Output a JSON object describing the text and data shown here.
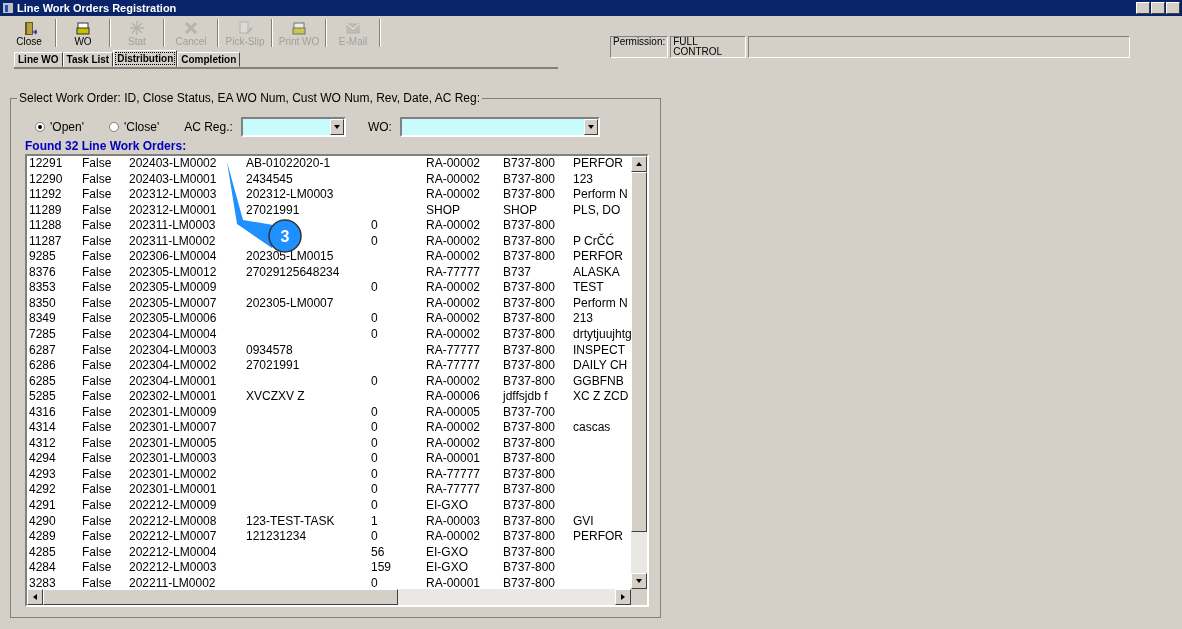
{
  "window": {
    "title": "Line Work Orders Registration"
  },
  "toolbar": [
    {
      "label": "Close",
      "kind": "door",
      "disabled": false
    },
    {
      "label": "WO",
      "kind": "printer",
      "disabled": false
    },
    {
      "label": "Stat",
      "kind": "star",
      "disabled": true
    },
    {
      "label": "Cancel",
      "kind": "cross",
      "disabled": true
    },
    {
      "label": "Pick-Slip",
      "kind": "slip",
      "disabled": true
    },
    {
      "label": "Print WO",
      "kind": "printer",
      "disabled": true
    },
    {
      "label": "E-Mail",
      "kind": "mail",
      "disabled": true
    }
  ],
  "permission": {
    "label": "Permission:",
    "value": "FULL CONTROL"
  },
  "tabs": [
    {
      "label": "Line WO",
      "selected": false
    },
    {
      "label": "Task List",
      "selected": false
    },
    {
      "label": "Distribution",
      "selected": true
    },
    {
      "label": "Completion",
      "selected": false
    }
  ],
  "group": {
    "title": "Select Work Order: ID, Close Status, EA WO Num, Cust WO Num, Rev, Date, AC Reg:",
    "radios": [
      {
        "label": "'Open'",
        "selected": true
      },
      {
        "label": "'Close'",
        "selected": false
      }
    ],
    "ac_reg": {
      "label": "AC Reg.:"
    },
    "wo": {
      "label": "WO:"
    },
    "found": "Found 32 Line Work Orders:",
    "rows": [
      [
        "12291",
        "False",
        "202403-LM0002",
        "AB-01022020-1",
        "",
        "RA-00002",
        "B737-800",
        "PERFOR"
      ],
      [
        "12290",
        "False",
        "202403-LM0001",
        "2434545",
        "",
        "RA-00002",
        "B737-800",
        "123"
      ],
      [
        "11292",
        "False",
        "202312-LM0003",
        "202312-LM0003",
        "",
        "RA-00002",
        "B737-800",
        "Perform N"
      ],
      [
        "11289",
        "False",
        "202312-LM0001",
        "27021991",
        "",
        "SHOP",
        "SHOP",
        "PLS, DO"
      ],
      [
        "11288",
        "False",
        "202311-LM0003",
        "",
        "0",
        "RA-00002",
        "B737-800",
        ""
      ],
      [
        "11287",
        "False",
        "202311-LM0002",
        "",
        "0",
        "RA-00002",
        "B737-800",
        "P CrČĆ"
      ],
      [
        "9285",
        "False",
        "202306-LM0004",
        "202305-LM0015",
        "",
        "RA-00002",
        "B737-800",
        "PERFOR"
      ],
      [
        "8376",
        "False",
        "202305-LM0012",
        "27029125648234",
        "",
        "RA-77777",
        "B737",
        "ALASKA"
      ],
      [
        "8353",
        "False",
        "202305-LM0009",
        "",
        "0",
        "RA-00002",
        "B737-800",
        "TEST"
      ],
      [
        "8350",
        "False",
        "202305-LM0007",
        "202305-LM0007",
        "",
        "RA-00002",
        "B737-800",
        "Perform N"
      ],
      [
        "8349",
        "False",
        "202305-LM0006",
        "",
        "0",
        "RA-00002",
        "B737-800",
        "213"
      ],
      [
        "7285",
        "False",
        "202304-LM0004",
        "",
        "0",
        "RA-00002",
        "B737-800",
        "drtytjuujhtg"
      ],
      [
        "6287",
        "False",
        "202304-LM0003",
        "0934578",
        "",
        "RA-77777",
        "B737-800",
        "INSPECT"
      ],
      [
        "6286",
        "False",
        "202304-LM0002",
        "27021991",
        "",
        "RA-77777",
        "B737-800",
        "DAILY CH"
      ],
      [
        "6285",
        "False",
        "202304-LM0001",
        "",
        "0",
        "RA-00002",
        "B737-800",
        "GGBFNB"
      ],
      [
        "5285",
        "False",
        "202302-LM0001",
        "XVCZXV Z",
        "",
        "RA-00006",
        "jdffsjdb f",
        "XC Z ZCD"
      ],
      [
        "4316",
        "False",
        "202301-LM0009",
        "",
        "0",
        "RA-00005",
        "B737-700",
        ""
      ],
      [
        "4314",
        "False",
        "202301-LM0007",
        "",
        "0",
        "RA-00002",
        "B737-800",
        "cascas"
      ],
      [
        "4312",
        "False",
        "202301-LM0005",
        "",
        "0",
        "RA-00002",
        "B737-800",
        ""
      ],
      [
        "4294",
        "False",
        "202301-LM0003",
        "",
        "0",
        "RA-00001",
        "B737-800",
        ""
      ],
      [
        "4293",
        "False",
        "202301-LM0002",
        "",
        "0",
        "RA-77777",
        "B737-800",
        ""
      ],
      [
        "4292",
        "False",
        "202301-LM0001",
        "",
        "0",
        "RA-77777",
        "B737-800",
        ""
      ],
      [
        "4291",
        "False",
        "202212-LM0009",
        "",
        "0",
        "EI-GXO",
        "B737-800",
        ""
      ],
      [
        "4290",
        "False",
        "202212-LM0008",
        "123-TEST-TASK",
        "1",
        "RA-00003",
        "B737-800",
        "GVI"
      ],
      [
        "4289",
        "False",
        "202212-LM0007",
        "121231234",
        "0",
        "RA-00002",
        "B737-800",
        "PERFOR"
      ],
      [
        "4285",
        "False",
        "202212-LM0004",
        "",
        "56",
        "EI-GXO",
        "B737-800",
        ""
      ],
      [
        "4284",
        "False",
        "202212-LM0003",
        "",
        "159",
        "EI-GXO",
        "B737-800",
        ""
      ],
      [
        "3283",
        "False",
        "202211-LM0002",
        "",
        "0",
        "RA-00001",
        "B737-800",
        ""
      ]
    ]
  },
  "callout": {
    "label": "3"
  }
}
